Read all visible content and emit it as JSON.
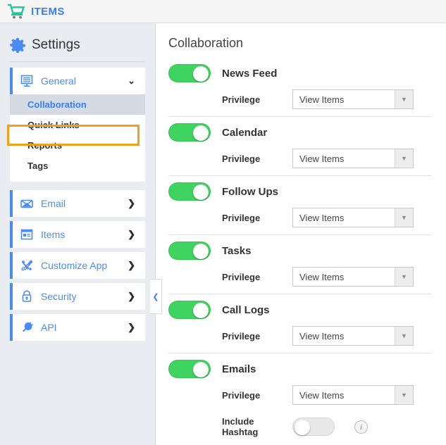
{
  "topbar": {
    "brand": "ITEMS",
    "logo_icon": "shopping-cart-icon",
    "brand_color": "#3b7df6",
    "logo_color": "#16c79a"
  },
  "sidebar": {
    "title": "Settings",
    "title_icon": "gear-icon",
    "groups": [
      {
        "label": "General",
        "icon": "monitor-icon",
        "chevron": "⌄",
        "expanded": true,
        "items": [
          {
            "label": "Collaboration",
            "active": true,
            "highlighted": true
          },
          {
            "label": "Quick Links",
            "active": false,
            "highlighted": false
          },
          {
            "label": "Reports",
            "active": false,
            "highlighted": false
          },
          {
            "label": "Tags",
            "active": false,
            "highlighted": false
          }
        ]
      }
    ],
    "links": [
      {
        "label": "Email",
        "icon": "envelope-icon",
        "chevron": "❯"
      },
      {
        "label": "Items",
        "icon": "window-list-icon",
        "chevron": "❯"
      },
      {
        "label": "Customize App",
        "icon": "tools-icon",
        "chevron": "❯"
      },
      {
        "label": "Security",
        "icon": "lock-icon",
        "chevron": "❯"
      },
      {
        "label": "API",
        "icon": "plug-icon",
        "chevron": "❯"
      }
    ],
    "collapse_handle": {
      "icon": "chevron-left-icon",
      "glyph": "❮"
    },
    "highlight_color": "#f0a01f",
    "accent_color": "#4a8cf7"
  },
  "main": {
    "title": "Collaboration",
    "privilege_label": "Privilege",
    "privilege_value": "View Items",
    "privilege_options": [
      "View Items"
    ],
    "dropdown_arrow": "▼",
    "toggle_on_color": "#3fd35f",
    "toggle_off_color": "#e8e8e8",
    "features": [
      {
        "name": "News Feed",
        "enabled": true,
        "has_privilege": true,
        "privilege": "View Items"
      },
      {
        "name": "Calendar",
        "enabled": true,
        "has_privilege": true,
        "privilege": "View Items"
      },
      {
        "name": "Follow Ups",
        "enabled": true,
        "has_privilege": true,
        "privilege": "View Items"
      },
      {
        "name": "Tasks",
        "enabled": true,
        "has_privilege": true,
        "privilege": "View Items"
      },
      {
        "name": "Call Logs",
        "enabled": true,
        "has_privilege": true,
        "privilege": "View Items"
      },
      {
        "name": "Emails",
        "enabled": true,
        "has_privilege": true,
        "privilege": "View Items",
        "extra": {
          "label": "Include Hashtag",
          "enabled": false,
          "info_icon": "info-icon",
          "info_glyph": "i"
        }
      }
    ]
  }
}
